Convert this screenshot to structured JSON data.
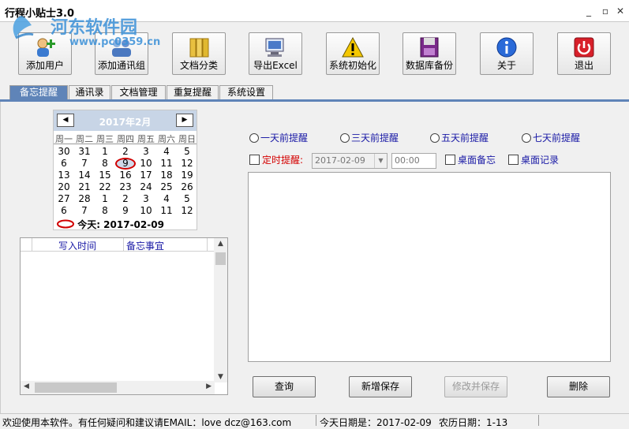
{
  "window": {
    "title": "行程小贴士3.0"
  },
  "watermark": {
    "site": "河东软件园",
    "url": "www.pc0359.cn"
  },
  "toolbar": {
    "buttons": [
      {
        "label": "添加用户",
        "icon": "add-user-icon"
      },
      {
        "label": "添加通讯组",
        "icon": "add-contact-group-icon"
      },
      {
        "label": "文档分类",
        "icon": "folder-icon"
      },
      {
        "label": "导出Excel",
        "icon": "export-excel-icon"
      },
      {
        "label": "系统初始化",
        "icon": "warning-icon"
      },
      {
        "label": "数据库备份",
        "icon": "floppy-icon"
      },
      {
        "label": "关于",
        "icon": "info-icon"
      },
      {
        "label": "退出",
        "icon": "power-icon"
      }
    ]
  },
  "tabs": [
    {
      "label": "备忘提醒",
      "active": true
    },
    {
      "label": "通讯录",
      "active": false
    },
    {
      "label": "文档管理",
      "active": false
    },
    {
      "label": "重复提醒",
      "active": false
    },
    {
      "label": "系统设置",
      "active": false
    }
  ],
  "calendar": {
    "month_label": "2017年2月",
    "prev": "◀",
    "next": "▶",
    "weekdays": [
      "周一",
      "周二",
      "周三",
      "周四",
      "周五",
      "周六",
      "周日"
    ],
    "weeks": [
      [
        "30",
        "31",
        "1",
        "2",
        "3",
        "4",
        "5"
      ],
      [
        "6",
        "7",
        "8",
        "9",
        "10",
        "11",
        "12"
      ],
      [
        "13",
        "14",
        "15",
        "16",
        "17",
        "18",
        "19"
      ],
      [
        "20",
        "21",
        "22",
        "23",
        "24",
        "25",
        "26"
      ],
      [
        "27",
        "28",
        "1",
        "2",
        "3",
        "4",
        "5"
      ],
      [
        "6",
        "7",
        "8",
        "9",
        "10",
        "11",
        "12"
      ]
    ],
    "selected_day": "9",
    "today_label": "今天: 2017-02-09"
  },
  "memo_list": {
    "columns": [
      "写入时间",
      "备忘事宜"
    ]
  },
  "reminder_options": {
    "radios": [
      "一天前提醒",
      "三天前提醒",
      "五天前提醒",
      "七天前提醒"
    ],
    "timed_label": "定时提醒:",
    "date_value": "2017-02-09",
    "time_value": "00:00",
    "desktop_memo": "桌面备忘",
    "desktop_record": "桌面记录"
  },
  "actions": {
    "query": "查询",
    "add_save": "新增保存",
    "modify_save": "修改并保存",
    "delete": "删除"
  },
  "status": {
    "welcome": "欢迎使用本软件。有任何疑问和建议请EMAIL：love dcz@163.com",
    "today": "今天日期是：2017-02-09",
    "lunar": "农历日期：1-13"
  },
  "colors": {
    "accent": "#5f84b8",
    "link_text": "#1a1aa6",
    "timed_red": "#d40000"
  }
}
